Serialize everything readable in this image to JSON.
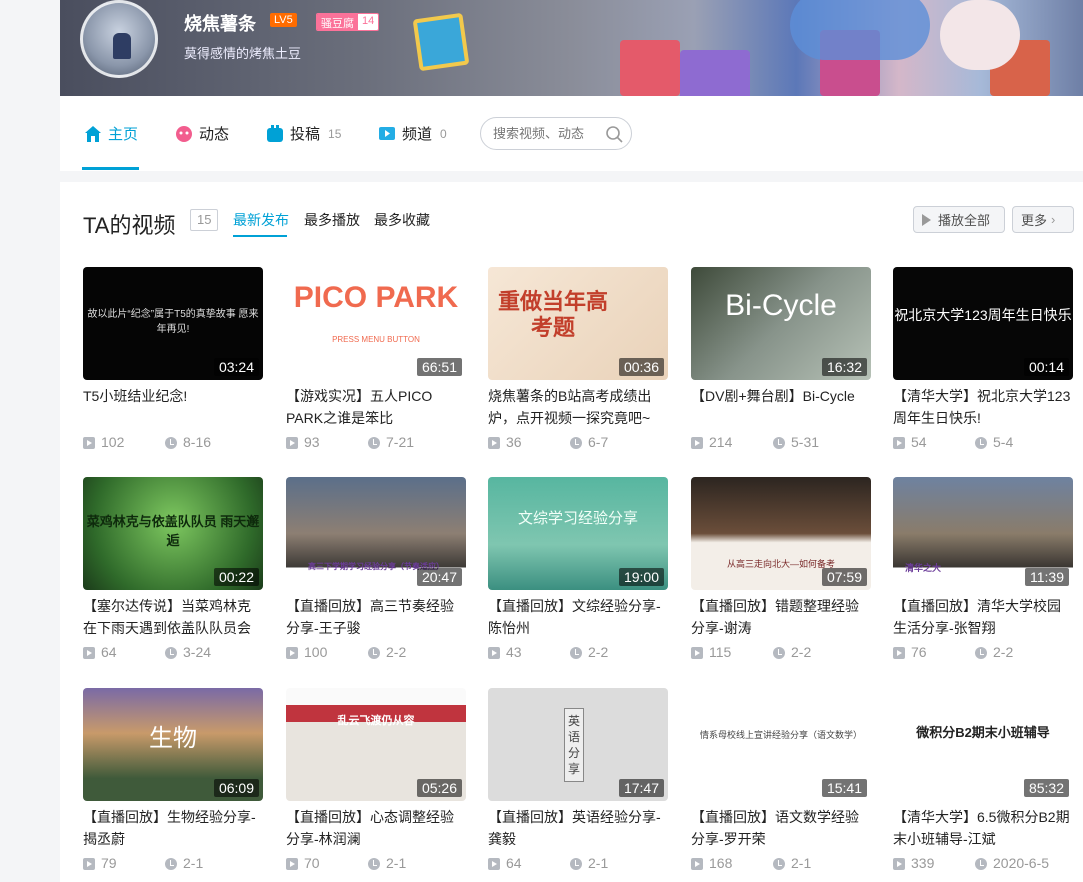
{
  "profile": {
    "name": "烧焦薯条",
    "level": "LV5",
    "medal_name": "骚豆腐",
    "medal_level": "14",
    "sign": "莫得感情的烤焦土豆"
  },
  "nav": {
    "home": "主页",
    "dynamic": "动态",
    "submit": "投稿",
    "submit_count": "15",
    "channel": "频道",
    "channel_count": "0",
    "search_placeholder": "搜索视频、动态"
  },
  "section": {
    "title": "TA的视频",
    "count": "15",
    "tabs": [
      "最新发布",
      "最多播放",
      "最多收藏"
    ],
    "play_all": "播放全部",
    "more": "更多"
  },
  "colors": {
    "accent": "#00a1d6",
    "level_badge": "#ff6c00",
    "medal": "#fb7299"
  },
  "videos": [
    {
      "title": "T5小班结业纪念!",
      "duration": "03:24",
      "plays": "102",
      "date": "8-16",
      "thumb_text": "故以此片“纪念”属于T5的真挚故事 愿来年再见!"
    },
    {
      "title": "【游戏实况】五人PICO PARK之谁是笨比",
      "duration": "66:51",
      "plays": "93",
      "date": "7-21",
      "thumb_text": "PICO PARK",
      "thumb_sub": "PRESS MENU BUTTON"
    },
    {
      "title": "烧焦薯条的B站高考成绩出炉，点开视频一探究竟吧~",
      "duration": "00:36",
      "plays": "36",
      "date": "6-7",
      "thumb_text": "重做当年高考题"
    },
    {
      "title": "【DV剧+舞台剧】Bi-Cycle",
      "duration": "16:32",
      "plays": "214",
      "date": "5-31",
      "thumb_text": "Bi-Cycle"
    },
    {
      "title": "【清华大学】祝北京大学123周年生日快乐!",
      "duration": "00:14",
      "plays": "54",
      "date": "5-4",
      "thumb_text": "祝北京大学123周年生日快乐"
    },
    {
      "title": "【塞尔达传说】当菜鸡林克在下雨天遇到依盖队队员会发生",
      "duration": "00:22",
      "plays": "64",
      "date": "3-24",
      "thumb_text": "菜鸡林克与依盖队队员 雨天邂逅"
    },
    {
      "title": "【直播回放】高三节奏经验分享-王子骏",
      "duration": "20:47",
      "plays": "100",
      "date": "2-2",
      "thumb_text": "高三下学期学习经验分享（节奏适应）"
    },
    {
      "title": "【直播回放】文综经验分享-陈怡州",
      "duration": "19:00",
      "plays": "43",
      "date": "2-2",
      "thumb_text": "文综学习经验分享"
    },
    {
      "title": "【直播回放】错题整理经验分享-谢涛",
      "duration": "07:59",
      "plays": "115",
      "date": "2-2",
      "thumb_text": "从高三走向北大—如何备考"
    },
    {
      "title": "【直播回放】清华大学校园生活分享-张智翔",
      "duration": "11:39",
      "plays": "76",
      "date": "2-2",
      "thumb_text": "清华之大"
    },
    {
      "title": "【直播回放】生物经验分享-揭丞蔚",
      "duration": "06:09",
      "plays": "79",
      "date": "2-1",
      "thumb_text": "生物"
    },
    {
      "title": "【直播回放】心态调整经验分享-林润澜",
      "duration": "05:26",
      "plays": "70",
      "date": "2-1",
      "thumb_text": "乱云飞渡仍从容"
    },
    {
      "title": "【直播回放】英语经验分享-龚毅",
      "duration": "17:47",
      "plays": "64",
      "date": "2-1",
      "thumb_text": "英语分享"
    },
    {
      "title": "【直播回放】语文数学经验分享-罗开荣",
      "duration": "15:41",
      "plays": "168",
      "date": "2-1",
      "thumb_text": "情系母校线上宣讲经验分享（语文数学）"
    },
    {
      "title": "【清华大学】6.5微积分B2期末小班辅导-江斌",
      "duration": "85:32",
      "plays": "339",
      "date": "2020-6-5",
      "thumb_text": "微积分B2期末小班辅导"
    }
  ]
}
